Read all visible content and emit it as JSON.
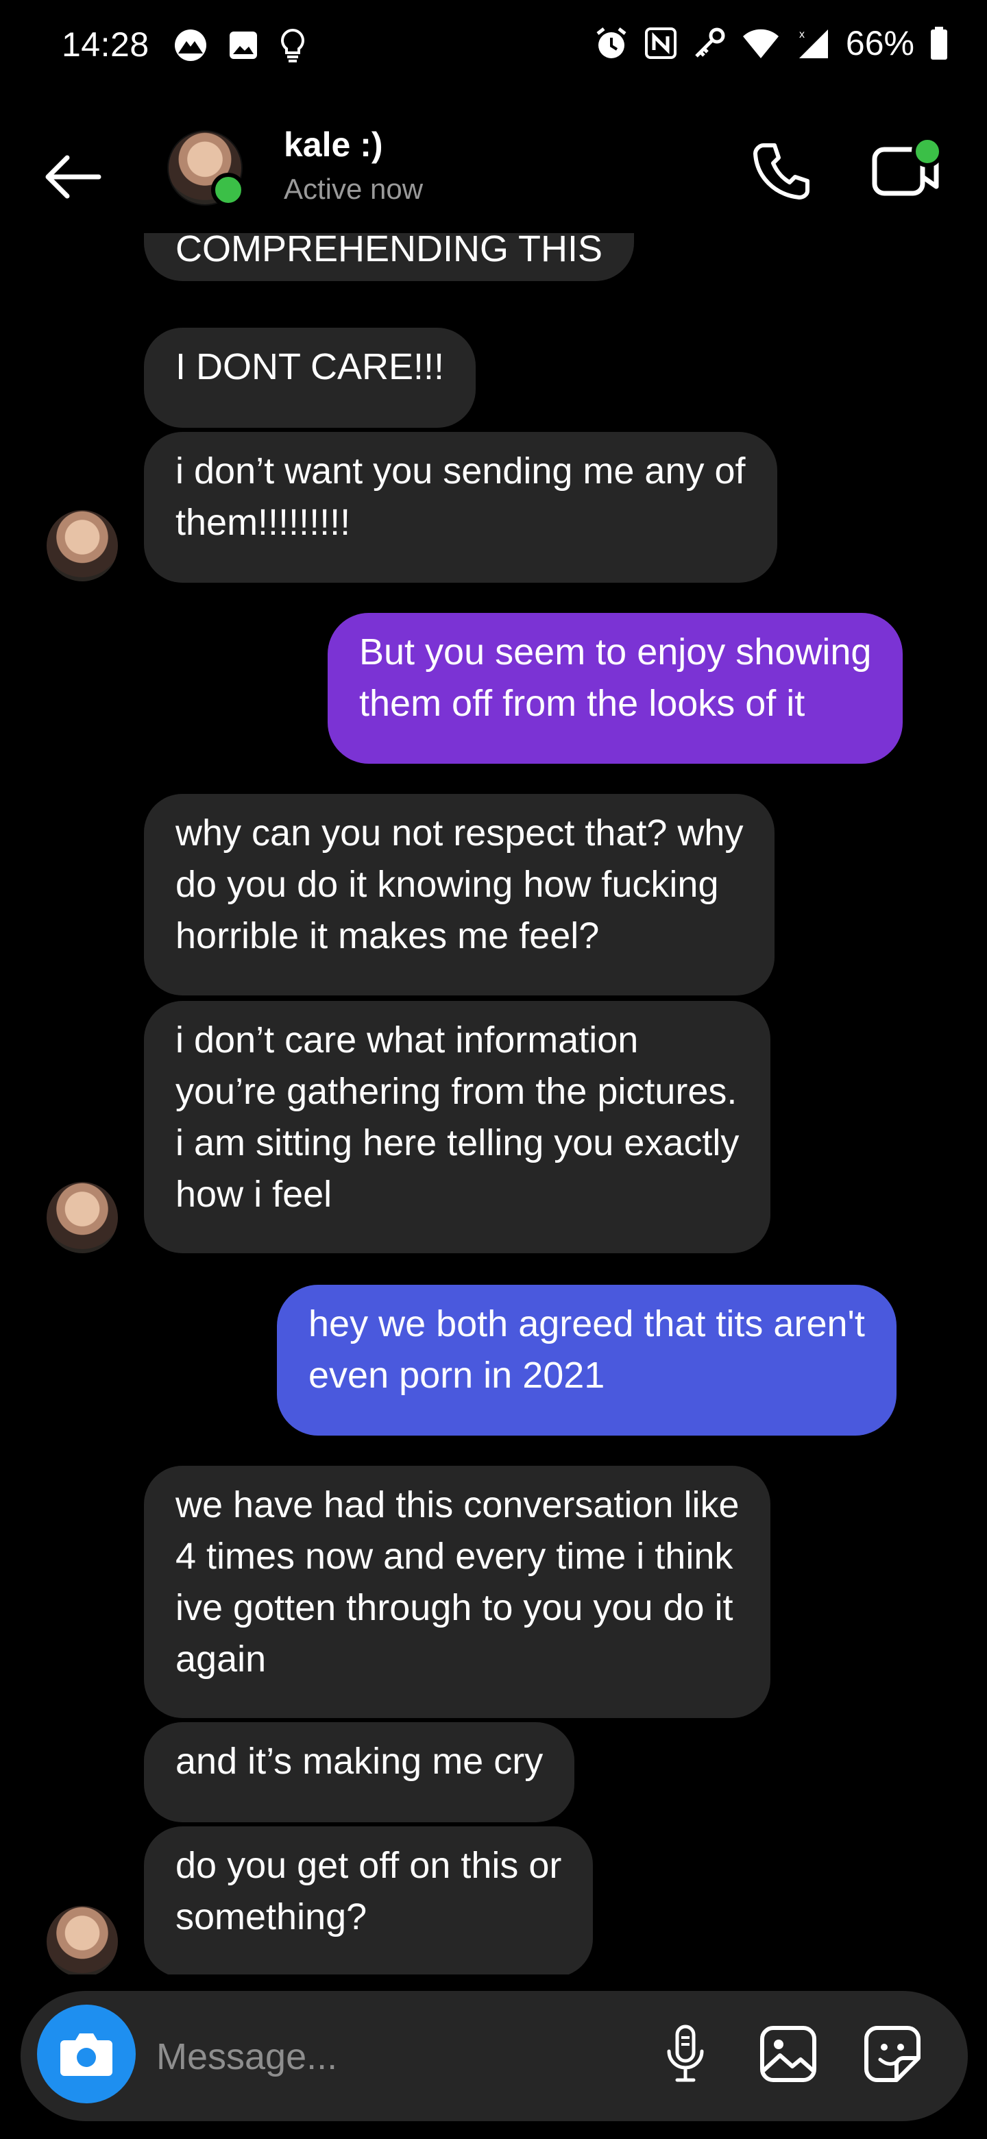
{
  "status_bar": {
    "time": "14:28",
    "battery": "66%",
    "left_icons": [
      "app-notification-icon",
      "gallery-icon",
      "lightbulb-icon"
    ],
    "right_icons": [
      "alarm-icon",
      "nfc-icon",
      "key-icon",
      "wifi-icon",
      "signal-icon",
      "battery-icon"
    ]
  },
  "header": {
    "contact_name": "kale :)",
    "status": "Active now",
    "actions": [
      "phone-icon",
      "video-call-icon"
    ]
  },
  "messages": [
    {
      "side": "in",
      "lines": [
        "COMPREHENDING THIS"
      ]
    },
    {
      "side": "in",
      "lines": [
        "I DONT CARE!!!"
      ]
    },
    {
      "side": "in",
      "lines": [
        "i don’t want you sending me any of",
        "them!!!!!!!!!"
      ]
    },
    {
      "side": "out",
      "lines": [
        "But you seem to enjoy showing",
        "them off from the looks of it"
      ]
    },
    {
      "side": "in",
      "lines": [
        "why can you not respect that? why",
        "do you do it knowing how fucking",
        "horrible it makes me feel?"
      ]
    },
    {
      "side": "in",
      "lines": [
        "i don’t care what information",
        "you’re gathering from the pictures.",
        "i am sitting here telling you exactly",
        "how i feel"
      ]
    },
    {
      "side": "out",
      "lines": [
        "hey we both agreed that tits aren't",
        "even porn in 2021"
      ]
    },
    {
      "side": "in",
      "lines": [
        "we have had this conversation like",
        "4 times now and every time i think",
        "ive gotten through to you you do it",
        "again"
      ]
    },
    {
      "side": "in",
      "lines": [
        "and it’s making me cry"
      ]
    },
    {
      "side": "in",
      "lines": [
        "do you get off on this or",
        "something?"
      ]
    }
  ],
  "composer": {
    "placeholder": "Message...",
    "icons": [
      "camera-icon",
      "microphone-icon",
      "image-icon",
      "sticker-icon"
    ]
  },
  "colors": {
    "background": "#000000",
    "incoming_bubble": "#262626",
    "outgoing_bubble_1": "#7b33d4",
    "outgoing_bubble_2": "#4a59dd",
    "active_dot": "#3bbf47",
    "camera_button": "#1e8ff0"
  }
}
